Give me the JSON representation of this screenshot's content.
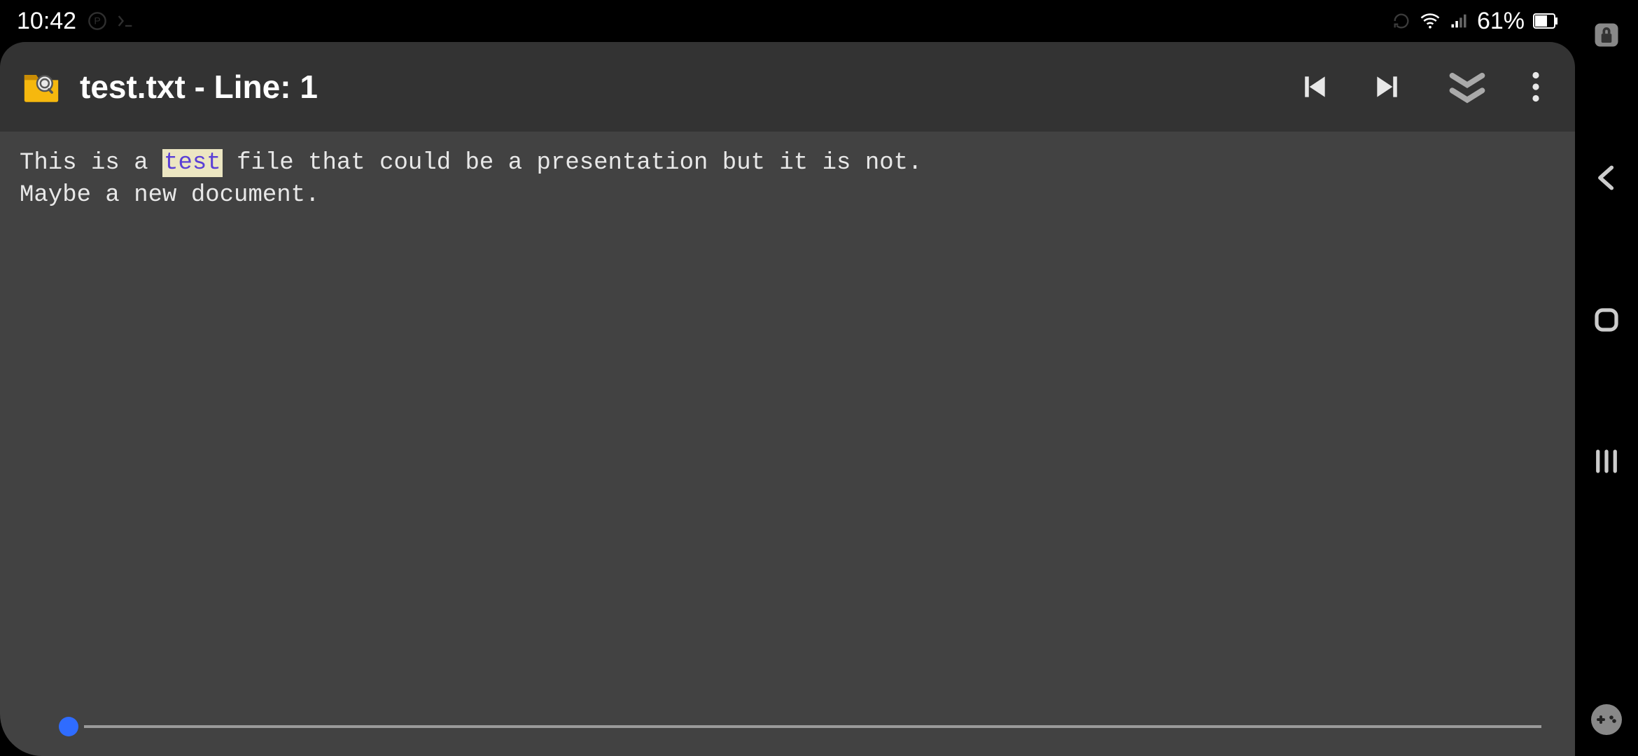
{
  "status": {
    "time": "10:42",
    "battery": "61%"
  },
  "appbar": {
    "title": "test.txt - Line: 1"
  },
  "content": {
    "line1_before": "This is a ",
    "line1_highlight": "test",
    "line1_after": " file that could be a presentation but it is not.",
    "line2": "Maybe a new document."
  }
}
